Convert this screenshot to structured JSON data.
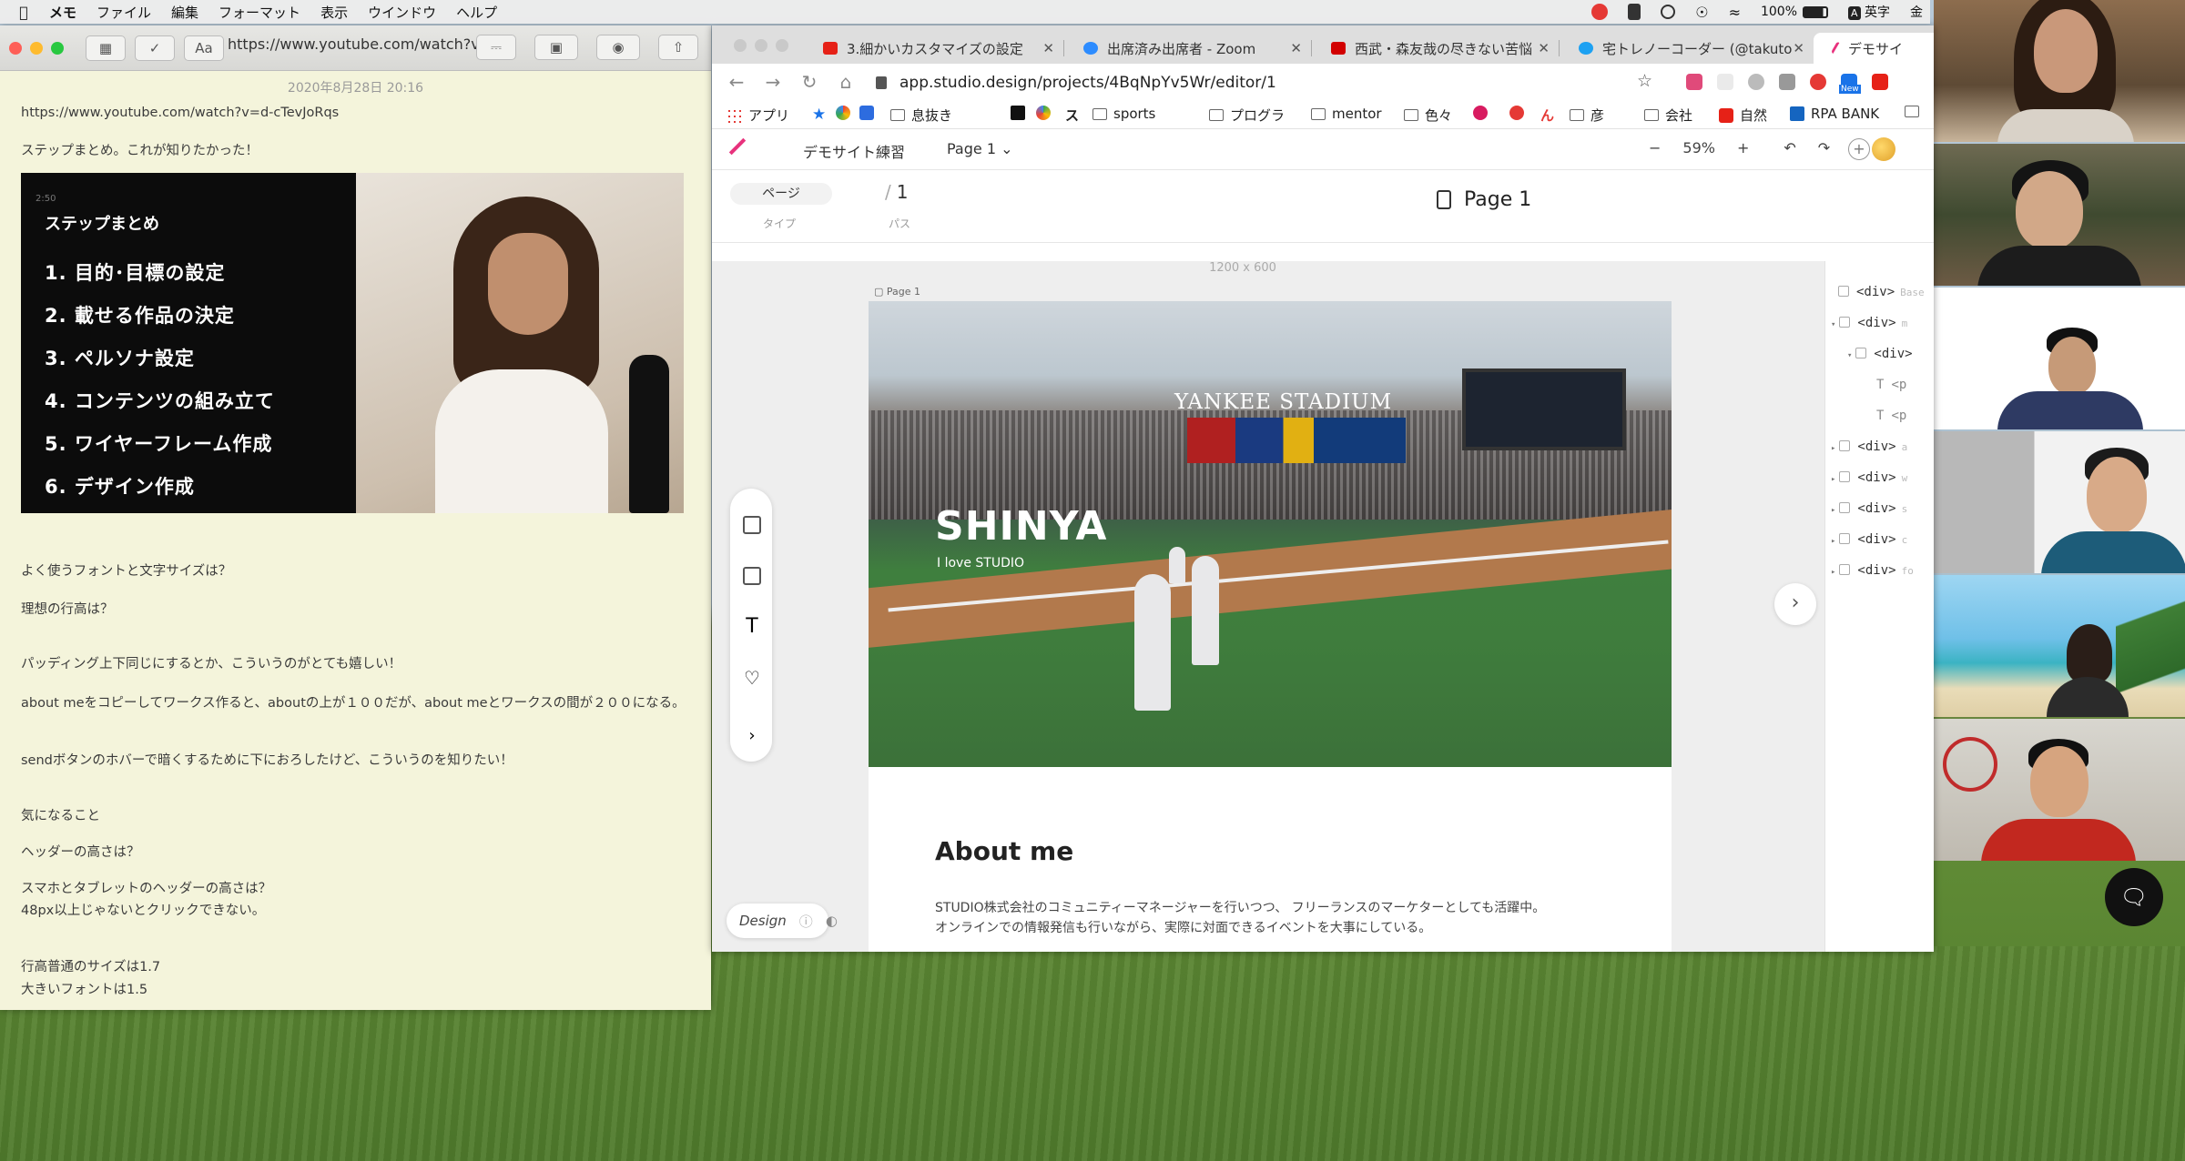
{
  "menubar": {
    "items": [
      "メモ",
      "ファイル",
      "編集",
      "フォーマット",
      "表示",
      "ウインドウ",
      "ヘルプ"
    ],
    "battery": "100%",
    "ime": "A",
    "ime_label": "英字",
    "day": "金"
  },
  "notes": {
    "url": "https://www.youtube.com/watch?v=...",
    "date": "2020年8月28日 20:16",
    "lines": [
      "https://www.youtube.com/watch?v=d-cTevJoRqs",
      "ステップまとめ。これが知りたかった！",
      "よく使うフォントと文字サイズは？",
      "理想の行高は？",
      "パッディング上下同じにするとか、こういうのがとても嬉しい！",
      "about meをコピーしてワークス作ると、aboutの上が１００だが、about meとワークスの間が２００になる。",
      "sendボタンのホバーで暗くするために下におろしたけど、こういうのを知りたい！",
      "気になること",
      "ヘッダーの高さは？",
      "スマホとタブレットのヘッダーの高さは？",
      "48px以上じゃないとクリックできない。",
      "行高普通のサイズは1.7",
      "大きいフォントは1.5"
    ],
    "video": {
      "time": "2:50",
      "title": "ステップまとめ",
      "steps": [
        "1. 目的･目標の設定",
        "2. 載せる作品の決定",
        "3. ペルソナ設定",
        "4. コンテンツの組み立て",
        "5. ワイヤーフレーム作成",
        "6. デザイン作成"
      ]
    }
  },
  "browser": {
    "tabs": [
      {
        "label": "3.細かいカスタマイズの設定",
        "fav": "#e62117"
      },
      {
        "label": "出席済み出席者 - Zoom",
        "fav": "#2d8cff"
      },
      {
        "label": "西武・森友哉の尽きない苦悩",
        "fav": "#d20000"
      },
      {
        "label": "宅トレノーコーダー (@takuto",
        "fav": "#1da1f2"
      },
      {
        "label": "デモサイ",
        "fav": "#e8327d"
      }
    ],
    "url": "app.studio.design/projects/4BqNpYv5Wr/editor/1",
    "bookmarks": [
      "アプリ",
      "息抜き",
      "sports",
      "プログラ",
      "mentor",
      "色々",
      "彦",
      "会社",
      "自然",
      "RPA BANK"
    ],
    "bookmark_glyphs": {
      "ji": "ス",
      "bull": "ん"
    },
    "ext_new": "New"
  },
  "studio": {
    "project": "デモサイト練習",
    "page_select": "Page 1",
    "zoom": "59%",
    "zoom_minus": "−",
    "zoom_plus": "+",
    "undo": "↶",
    "redo": "↷",
    "type_pill": "ページ",
    "type_label": "タイプ",
    "path_value": "1",
    "path_label": "パス",
    "page_title": "Page 1",
    "ruler": "1200 x 600",
    "artboard_label": "Page 1",
    "hero_title": "SHINYA",
    "hero_sub": "I love STUDIO",
    "stadium_sign": "YANKEE STADIUM",
    "about_heading": "About me",
    "about_lines": [
      "STUDIO株式会社のコミュニティーマネージャーを行いつつ、 フリーランスのマーケターとしても活躍中。",
      "オンラインでの情報発信も行いながら、実際に対面できるイベントを大事にしている。"
    ],
    "design_label": "Design",
    "layers": [
      {
        "text": "<div>",
        "sub": "Base"
      },
      {
        "text": "<div>",
        "sub": "m"
      },
      {
        "text": "<div>",
        "sub": ""
      },
      {
        "text": "<p",
        "sub": ""
      },
      {
        "text": "<p",
        "sub": ""
      },
      {
        "text": "<div>",
        "sub": "a"
      },
      {
        "text": "<div>",
        "sub": "w"
      },
      {
        "text": "<div>",
        "sub": "s"
      },
      {
        "text": "<div>",
        "sub": "c"
      },
      {
        "text": "<div>",
        "sub": "fo"
      }
    ]
  },
  "colors": {
    "accent": "#e8327d",
    "notes_bg": "#f4f4db"
  }
}
